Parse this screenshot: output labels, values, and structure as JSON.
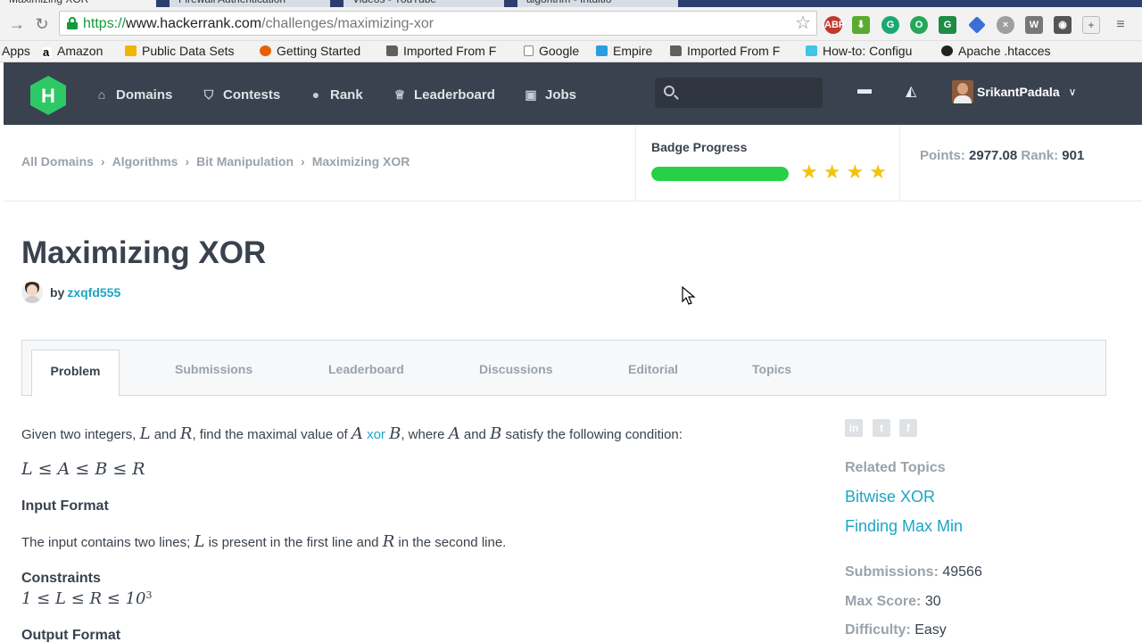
{
  "browser": {
    "tabs": [
      "Maximizing XOR",
      "Firewall Authentication",
      "Videos - YouTube",
      "algorithm - Intuitio"
    ],
    "url": {
      "scheme": "https://",
      "host": "www.hackerrank.com",
      "path": "/challenges/maximizing-xor"
    },
    "bookmarks": [
      "Apps",
      "Amazon",
      "Public Data Sets",
      "Getting Started",
      "Imported From F",
      "Google",
      "Empire",
      "Imported From F",
      "How-to: Configu",
      "Apache .htacces"
    ]
  },
  "navbar": {
    "items": [
      "Domains",
      "Contests",
      "Rank",
      "Leaderboard",
      "Jobs"
    ],
    "username": "SrikantPadala"
  },
  "breadcrumb": [
    "All Domains",
    "Algorithms",
    "Bit Manipulation",
    "Maximizing XOR"
  ],
  "badge": {
    "title": "Badge Progress",
    "progress": 1.0,
    "stars": 4
  },
  "stats": {
    "points_label": "Points:",
    "points": "2977.08",
    "rank_label": "Rank:",
    "rank": "901"
  },
  "challenge": {
    "title": "Maximizing XOR",
    "by": "by",
    "author": "zxqfd555"
  },
  "tabs": [
    "Problem",
    "Submissions",
    "Leaderboard",
    "Discussions",
    "Editorial",
    "Topics"
  ],
  "statement": {
    "p1_a": "Given two integers,",
    "p1_L": "L",
    "p1_and1": "and",
    "p1_R": "R",
    "p1_b": ", find the maximal value of",
    "p1_A": "A",
    "p1_xor": "xor",
    "p1_B": "B",
    "p1_c": ", where",
    "p1_A2": "A",
    "p1_and2": "and",
    "p1_B2": "B",
    "p1_d": "satisfy the following condition:",
    "condition": "L ≤ A ≤ B ≤ R",
    "input_heading": "Input Format",
    "input_a": "The input contains two lines;",
    "input_L": "L",
    "input_b": "is present in the first line and",
    "input_R": "R",
    "input_c": "in the second line.",
    "constraints_heading": "Constraints",
    "constraint": "1 ≤ L ≤ R ≤ 10",
    "constraint_exp": "3",
    "output_heading": "Output Format"
  },
  "sidebar": {
    "related_heading": "Related Topics",
    "topics": [
      "Bitwise XOR",
      "Finding Max Min"
    ],
    "submissions_label": "Submissions:",
    "submissions": "49566",
    "max_score_label": "Max Score:",
    "max_score": "30",
    "difficulty_label": "Difficulty:",
    "difficulty": "Easy",
    "social": [
      "linkedin-icon",
      "twitter-icon",
      "facebook-icon"
    ]
  },
  "colors": {
    "accent": "#1ba5c4",
    "nav_bg": "#39424e",
    "progress": "#27d044",
    "star": "#f1c40f",
    "logo": "#2ec866"
  }
}
